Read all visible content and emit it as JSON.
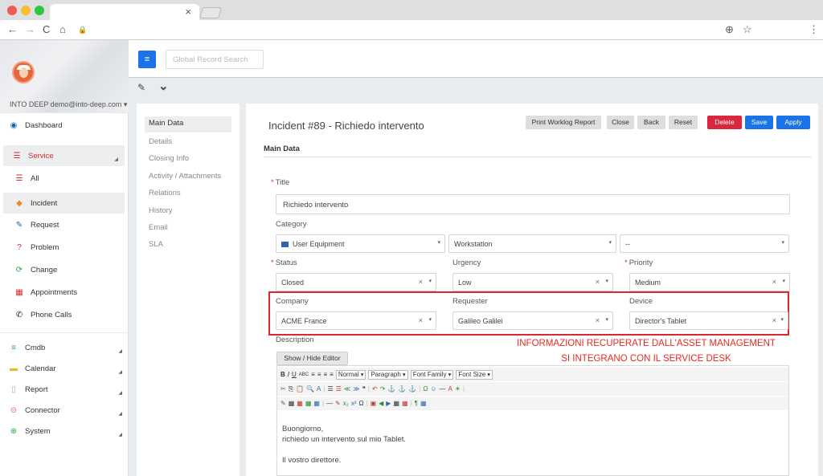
{
  "browser": {
    "tab_close": "×",
    "nav_icons": [
      "←",
      "→",
      "C",
      "⌂",
      "🔒"
    ],
    "right_icons": [
      "⊕",
      "☆",
      "⋮"
    ]
  },
  "sidebar": {
    "user": "INTO DEEP demo@into-deep.com ▾",
    "items": [
      {
        "label": "Dashboard",
        "icon": "dashboard-icon",
        "glyph": "◉",
        "color": "#1a5fb4"
      },
      {
        "label": "Service",
        "icon": "list-icon",
        "glyph": "☰",
        "color": "#d9282e"
      },
      {
        "label": "All",
        "icon": "list-icon",
        "glyph": "☰",
        "color": "#d9282e"
      },
      {
        "label": "Incident",
        "icon": "diamond-icon",
        "glyph": "◆",
        "color": "#f08a1c"
      },
      {
        "label": "Request",
        "icon": "edit-icon",
        "glyph": "✎",
        "color": "#1a5fb4"
      },
      {
        "label": "Problem",
        "icon": "question-icon",
        "glyph": "?",
        "color": "#d9282e"
      },
      {
        "label": "Change",
        "icon": "refresh-icon",
        "glyph": "⟳",
        "color": "#2aa64a"
      },
      {
        "label": "Appointments",
        "icon": "calendar-icon",
        "glyph": "▦",
        "color": "#d9282e"
      },
      {
        "label": "Phone Calls",
        "icon": "phone-icon",
        "glyph": "✆",
        "color": "#222"
      },
      {
        "label": "Cmdb",
        "icon": "database-icon",
        "glyph": "≡",
        "color": "#2aa64a"
      },
      {
        "label": "Calendar",
        "icon": "calendar-icon",
        "glyph": "▬",
        "color": "#f0b81c"
      },
      {
        "label": "Report",
        "icon": "document-icon",
        "glyph": "▯",
        "color": "#aaa"
      },
      {
        "label": "Connector",
        "icon": "connector-icon",
        "glyph": "⊝",
        "color": "#e06070"
      },
      {
        "label": "System",
        "icon": "globe-icon",
        "glyph": "⊕",
        "color": "#2aa64a"
      }
    ]
  },
  "topbar": {
    "menu_glyph": "≡",
    "search_placeholder": "Global Record Search"
  },
  "toolrow": {
    "edit_glyph": "✎",
    "chevron_glyph": "⌄"
  },
  "secnav": [
    "Main Data",
    "Details",
    "Closing Info",
    "Activity / Attachments",
    "Relations",
    "History",
    "Email",
    "SLA"
  ],
  "incident": {
    "heading": "Incident #89 - Richiedo intervento",
    "buttons": [
      {
        "label": "Print Worklog Report",
        "bg": "#dedede",
        "fg": "#333"
      },
      {
        "label": "Close",
        "bg": "#dedede",
        "fg": "#333"
      },
      {
        "label": "Back",
        "bg": "#dedede",
        "fg": "#333"
      },
      {
        "label": "Reset",
        "bg": "#dedede",
        "fg": "#333"
      },
      {
        "label": "Delete",
        "bg": "#d9283d",
        "fg": "#fff"
      },
      {
        "label": "Save",
        "bg": "#1a73e8",
        "fg": "#fff"
      },
      {
        "label": "Apply",
        "bg": "#1a73e8",
        "fg": "#fff"
      }
    ],
    "section": "Main Data",
    "title_label": "Title",
    "title_value": "Richiedo intervento",
    "category_label": "Category",
    "category": [
      "User Equipment",
      "Workstation",
      "--"
    ],
    "status_label": "Status",
    "status_value": "Closed",
    "urgency_label": "Urgency",
    "urgency_value": "Low",
    "priority_label": "Priority",
    "priority_value": "Medium",
    "company_label": "Company",
    "company_value": "ACME France",
    "requester_label": "Requester",
    "requester_value": "Galileo Galilei",
    "device_label": "Device",
    "device_value": "Director's Tablet",
    "description_label": "Description",
    "annotation_line1": "INFORMAZIONI RECUPERATE DALL'ASSET MANAGEMENT",
    "annotation_line2": "SI INTEGRANO CON IL SERVICE DESK",
    "clear_glyph": "×",
    "caret_glyph": "▾",
    "required_mark": "*"
  },
  "editor": {
    "toggle": "Show / Hide Editor",
    "format": "Normal",
    "paragraph": "Paragraph",
    "font_family": "Font Family",
    "font_size": "Font Size",
    "toolbar1_glyphs": [
      "B",
      "I",
      "U",
      "ABC",
      "≡",
      "≡",
      "≡",
      "≡"
    ],
    "toolbar2_glyphs": [
      "✂",
      "⎘",
      "📋",
      "🔍",
      "A",
      "☰",
      "☰",
      "≪",
      "≫",
      "❝",
      "↶",
      "↷",
      "⚓",
      "⚓",
      "⚓",
      "Ω",
      "☺",
      "—",
      "A",
      "☀"
    ],
    "toolbar3_glyphs": [
      "✎",
      "▦",
      "▦",
      "▦",
      "▦",
      "—",
      "✎",
      "x₂",
      "x²",
      "Ω",
      "▣",
      "◀",
      "▶",
      "▦",
      "▦",
      "¶",
      "▦"
    ],
    "body": [
      "Buongiorno,",
      "richiedo un intervento sul mio Tablet.",
      "",
      "Il vostro direttore."
    ]
  }
}
